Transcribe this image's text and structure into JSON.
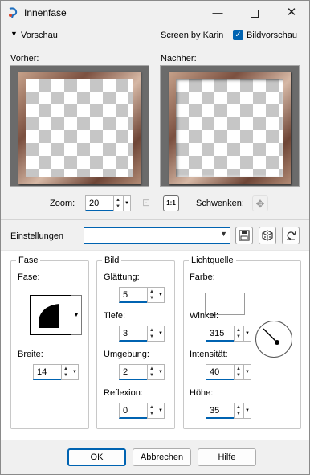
{
  "window": {
    "title": "Innenfase",
    "minimize_glyph": "—",
    "maximize_glyph": "",
    "close_glyph": "✕"
  },
  "preview": {
    "collapse_glyph": "▼",
    "label": "Vorschau",
    "screen_by": "Screen by Karin",
    "bildvorschau_label": "Bildvorschau",
    "bildvorschau_checked": true,
    "before_label": "Vorher:",
    "after_label": "Nachher:",
    "zoom_label": "Zoom:",
    "zoom_value": "20",
    "pan_label": "Schwenken:",
    "onetoone_text": "1:1"
  },
  "settings": {
    "label": "Einstellungen",
    "value": ""
  },
  "fase": {
    "title": "Fase",
    "shape_label": "Fase:",
    "width_label": "Breite:",
    "width_value": "14"
  },
  "bild": {
    "title": "Bild",
    "smoothing_label": "Glättung:",
    "smoothing_value": "5",
    "depth_label": "Tiefe:",
    "depth_value": "3",
    "ambience_label": "Umgebung:",
    "ambience_value": "2",
    "reflection_label": "Reflexion:",
    "reflection_value": "0"
  },
  "licht": {
    "title": "Lichtquelle",
    "color_label": "Farbe:",
    "color_value": "#ffffff",
    "angle_label": "Winkel:",
    "angle_value": "315",
    "intensity_label": "Intensität:",
    "intensity_value": "40",
    "height_label": "Höhe:",
    "height_value": "35"
  },
  "buttons": {
    "ok": "OK",
    "cancel": "Abbrechen",
    "help": "Hilfe"
  },
  "colors": {
    "accent": "#0063b1",
    "frame_dark": "#7b5040",
    "frame_light": "#d6b8a5"
  }
}
